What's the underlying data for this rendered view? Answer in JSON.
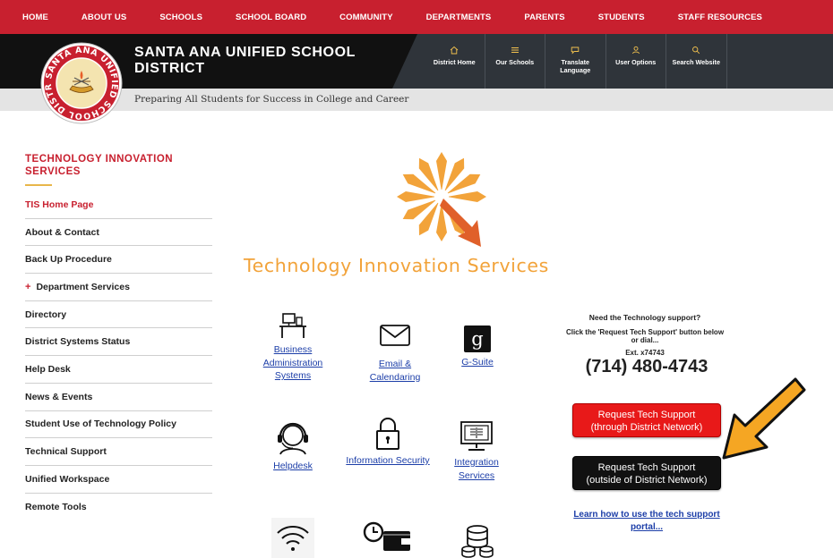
{
  "top_nav": [
    "HOME",
    "ABOUT US",
    "SCHOOLS",
    "SCHOOL BOARD",
    "COMMUNITY",
    "DEPARTMENTS",
    "PARENTS",
    "STUDENTS",
    "STAFF RESOURCES"
  ],
  "site": {
    "title": "SANTA ANA UNIFIED SCHOOL DISTRICT",
    "tagline": "Preparing All Students for Success in College and Career",
    "seal_text": "SANTA ANA UNIFIED SCHOOL DISTRICT"
  },
  "quick_links": [
    {
      "label": "District Home",
      "icon": "home-icon"
    },
    {
      "label": "Our Schools",
      "icon": "menu-icon"
    },
    {
      "label": "Translate Language",
      "icon": "chat-icon"
    },
    {
      "label": "User Options",
      "icon": "user-icon"
    },
    {
      "label": "Search Website",
      "icon": "search-icon"
    }
  ],
  "sidebar": {
    "title": "TECHNOLOGY INNOVATION SERVICES",
    "items": [
      {
        "label": "TIS Home Page",
        "active": true
      },
      {
        "label": "About & Contact"
      },
      {
        "label": "Back Up Procedure"
      },
      {
        "label": "Department Services",
        "expandable": true
      },
      {
        "label": "Directory"
      },
      {
        "label": "District Systems Status"
      },
      {
        "label": "Help Desk"
      },
      {
        "label": "News & Events"
      },
      {
        "label": "Student Use of Technology Policy"
      },
      {
        "label": "Technical Support"
      },
      {
        "label": "Unified Workspace"
      },
      {
        "label": "Remote Tools"
      }
    ]
  },
  "brand": {
    "text": "Technology Innovation Services",
    "colors": {
      "orange": "#f2a33a",
      "dark_orange": "#e0602a"
    }
  },
  "tiles": [
    {
      "label": "Business Administration Systems",
      "icon": "desk-computer-icon"
    },
    {
      "label": "Email & Calendaring",
      "icon": "envelope-icon"
    },
    {
      "label": "G-Suite",
      "icon": "google-icon"
    },
    {
      "label": "Helpdesk",
      "icon": "headset-icon"
    },
    {
      "label": "Information Security",
      "icon": "padlock-icon"
    },
    {
      "label": "Integration Services",
      "icon": "monitor-icon"
    },
    {
      "label": "",
      "icon": "wifi-icon"
    },
    {
      "label": "",
      "icon": "clock-wallet-icon"
    },
    {
      "label": "",
      "icon": "database-icon"
    }
  ],
  "support": {
    "question": "Need the Technology support?",
    "instruction": "Click the 'Request Tech Support' button below or dial...",
    "ext": "Ext. x74743",
    "phone": "(714) 480-4743",
    "btn_internal_line1": "Request Tech Support",
    "btn_internal_line2": "(through District Network)",
    "btn_external_line1": "Request Tech Support",
    "btn_external_line2": "(outside of District Network)",
    "learn_link": "Learn how to use the tech support portal..."
  },
  "colors": {
    "brand_red": "#c8202f",
    "header_dark": "#111111",
    "header_panel": "#2f343a",
    "link_blue": "#1c3ea8",
    "arrow_yellow": "#f5a623"
  }
}
